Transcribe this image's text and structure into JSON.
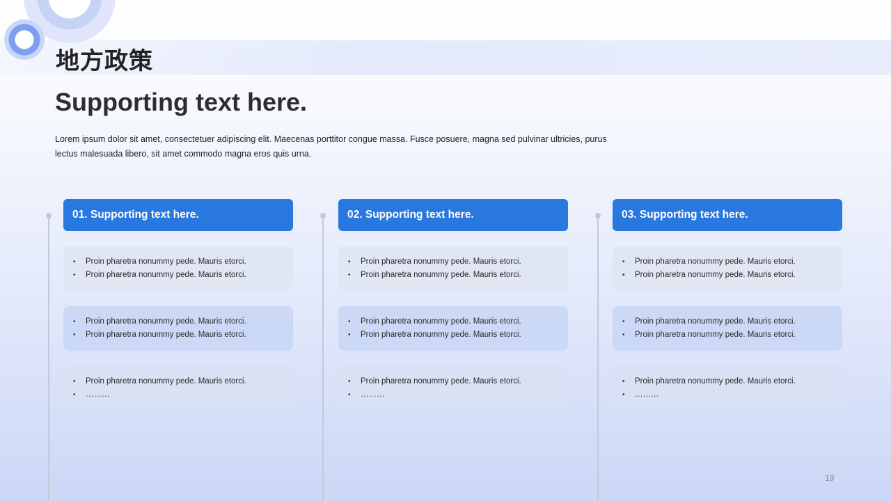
{
  "slide": {
    "title": "地方政策",
    "subtitle": "Supporting text here.",
    "body": "Lorem ipsum dolor sit amet, consectetuer adipiscing elit. Maecenas porttitor congue massa. Fusce posuere, magna sed pulvinar ultricies, purus lectus malesuada libero, sit amet commodo magna eros quis urna.",
    "page_number": "19"
  },
  "columns": [
    {
      "header": "01. Supporting text here.",
      "cards": [
        [
          "Proin pharetra nonummy pede. Mauris etorci.",
          "Proin pharetra nonummy pede. Mauris etorci."
        ],
        [
          "Proin pharetra nonummy pede. Mauris etorci.",
          "Proin pharetra nonummy pede. Mauris etorci."
        ],
        [
          "Proin pharetra nonummy pede. Mauris etorci.",
          "………"
        ]
      ]
    },
    {
      "header": "02. Supporting text here.",
      "cards": [
        [
          "Proin pharetra nonummy pede. Mauris etorci.",
          "Proin pharetra nonummy pede. Mauris etorci."
        ],
        [
          "Proin pharetra nonummy pede. Mauris etorci.",
          "Proin pharetra nonummy pede. Mauris etorci."
        ],
        [
          "Proin pharetra nonummy pede. Mauris etorci.",
          "………"
        ]
      ]
    },
    {
      "header": "03. Supporting text here.",
      "cards": [
        [
          "Proin pharetra nonummy pede. Mauris etorci.",
          "Proin pharetra nonummy pede. Mauris etorci."
        ],
        [
          "Proin pharetra nonummy pede. Mauris etorci.",
          "Proin pharetra nonummy pede. Mauris etorci."
        ],
        [
          "Proin pharetra nonummy pede. Mauris etorci.",
          "………"
        ]
      ]
    }
  ],
  "bullet_glyph": "•",
  "colors": {
    "header_blue": "#2878e0",
    "card_gray": "#e1e6f3",
    "card_blue": "#cbd9f7",
    "timeline": "#c2c9d8"
  }
}
